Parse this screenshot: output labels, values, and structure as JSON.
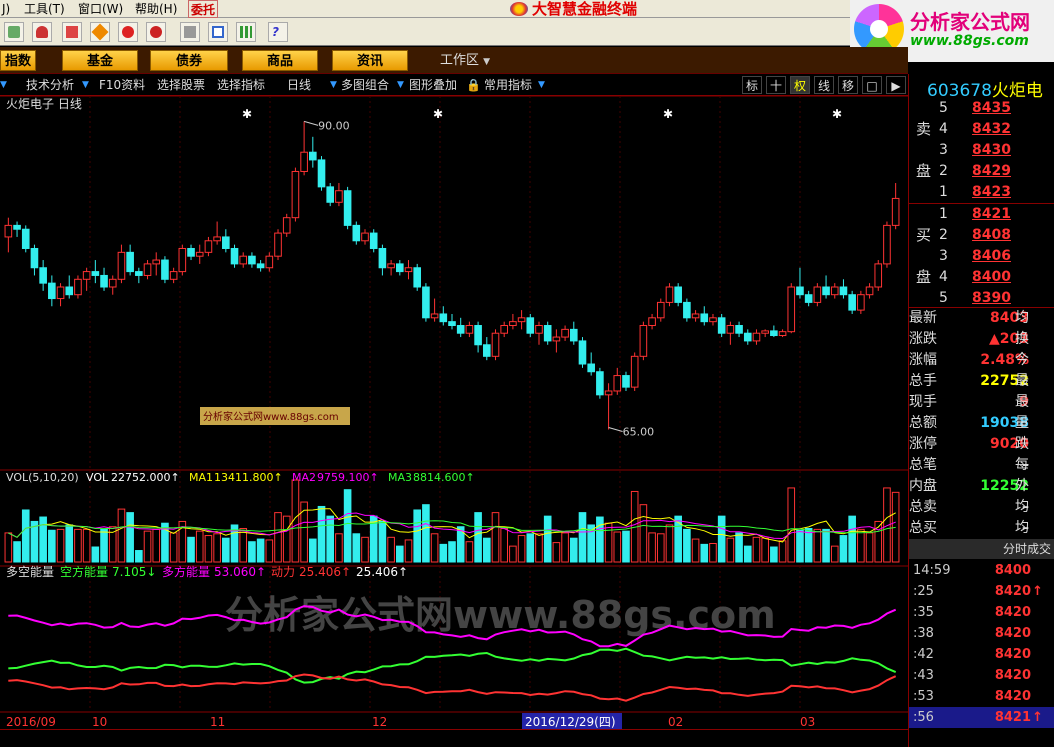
{
  "menu": {
    "items": [
      "J)",
      "工具(T)",
      "窗口(W)",
      "帮助(H)",
      "委托"
    ],
    "title": "大智慧金融终端"
  },
  "brand": {
    "name": "分析家公式网",
    "url": "www.88gs.com"
  },
  "categories": [
    "指数",
    "基金",
    "债券",
    "商品",
    "资讯"
  ],
  "workspace": "工作区",
  "funcbar": {
    "items": [
      "技术分析",
      "F10资料",
      "选择股票",
      "选择指标",
      "日线",
      "多图组合",
      "图形叠加",
      "常用指标"
    ],
    "right": [
      "标",
      "十",
      "权",
      "线",
      "移",
      "",
      ""
    ]
  },
  "stock": {
    "code": "603678",
    "name": "火炬电"
  },
  "orderbook": {
    "sell_label": [
      "卖",
      "盘"
    ],
    "buy_label": [
      "买",
      "盘"
    ],
    "sell": [
      {
        "level": "5",
        "price": "8435"
      },
      {
        "level": "4",
        "price": "8432"
      },
      {
        "level": "3",
        "price": "8430"
      },
      {
        "level": "2",
        "price": "8429"
      },
      {
        "level": "1",
        "price": "8423"
      }
    ],
    "buy": [
      {
        "level": "1",
        "price": "8421"
      },
      {
        "level": "2",
        "price": "8408"
      },
      {
        "level": "3",
        "price": "8406"
      },
      {
        "level": "4",
        "price": "8400"
      },
      {
        "level": "5",
        "price": "8390"
      }
    ]
  },
  "quote": [
    {
      "label": "最新",
      "value": "8403",
      "color": "#f33",
      "extra": "均"
    },
    {
      "label": "涨跌",
      "value": "▲203",
      "color": "#f33",
      "extra": "换"
    },
    {
      "label": "涨幅",
      "value": "2.48%",
      "color": "#f33",
      "extra": "今"
    },
    {
      "label": "总手",
      "value": "22752",
      "color": "#ff0",
      "extra": "最"
    },
    {
      "label": "现手",
      "value": "9",
      "color": "#f33",
      "extra": "最"
    },
    {
      "label": "总额",
      "value": "19038",
      "color": "#3cf",
      "extra": "量"
    },
    {
      "label": "涨停",
      "value": "9020",
      "color": "#f33",
      "extra": "跌"
    },
    {
      "label": "总笔",
      "value": "–",
      "color": "#ddd",
      "extra": "每"
    },
    {
      "label": "内盘",
      "value": "12252",
      "color": "#3f3",
      "extra": "外"
    },
    {
      "label": "总卖",
      "value": "–",
      "color": "#ddd",
      "extra": "均"
    },
    {
      "label": "总买",
      "value": "–",
      "color": "#ddd",
      "extra": "均"
    }
  ],
  "ticks_title": "分时成交",
  "ticks": [
    {
      "time": "14:59",
      "price": "8400",
      "arrow": ""
    },
    {
      "time": ":25",
      "price": "8420",
      "arrow": "↑"
    },
    {
      "time": ":35",
      "price": "8420",
      "arrow": ""
    },
    {
      "time": ":38",
      "price": "8420",
      "arrow": ""
    },
    {
      "time": ":42",
      "price": "8420",
      "arrow": ""
    },
    {
      "time": ":43",
      "price": "8420",
      "arrow": ""
    },
    {
      "time": ":53",
      "price": "8420",
      "arrow": ""
    },
    {
      "time": ":56",
      "price": "8421",
      "arrow": "↑"
    }
  ],
  "chart_data": {
    "type": "candlestick",
    "title": "火炬电子 日线",
    "price_max_label": "90.00",
    "price_min_label": "65.00",
    "date_cursor": "2016/12/29(四)",
    "x_labels": [
      "2016/09",
      "10",
      "11",
      "12",
      "01",
      "02",
      "03"
    ],
    "candles": [
      [
        75,
        77.5,
        73,
        76.5
      ],
      [
        76.5,
        77,
        75,
        76
      ],
      [
        76,
        76.5,
        73,
        73.5
      ],
      [
        73.5,
        74,
        70,
        71
      ],
      [
        71,
        72,
        68,
        69
      ],
      [
        69,
        70,
        66,
        67
      ],
      [
        67,
        69,
        66,
        68.5
      ],
      [
        68.5,
        70,
        67,
        67.5
      ],
      [
        67.5,
        70,
        67,
        69.5
      ],
      [
        69.5,
        71,
        68,
        70.5
      ],
      [
        70.5,
        72,
        69,
        70
      ],
      [
        70,
        71,
        68,
        68.5
      ],
      [
        68.5,
        70,
        67.5,
        69.5
      ],
      [
        69.5,
        74,
        69,
        73
      ],
      [
        73,
        74,
        70,
        70.5
      ],
      [
        70.5,
        71,
        69,
        70
      ],
      [
        70,
        72,
        69.5,
        71.5
      ],
      [
        71.5,
        73,
        70,
        72
      ],
      [
        72,
        72.5,
        69,
        69.5
      ],
      [
        69.5,
        71,
        69,
        70.5
      ],
      [
        70.5,
        74,
        70,
        73.5
      ],
      [
        73.5,
        74,
        72,
        72.5
      ],
      [
        72.5,
        74,
        71.5,
        73
      ],
      [
        73,
        75,
        72.5,
        74.5
      ],
      [
        74.5,
        77,
        74,
        75
      ],
      [
        75,
        76,
        73,
        73.5
      ],
      [
        73.5,
        74,
        71,
        71.5
      ],
      [
        71.5,
        73,
        71,
        72.5
      ],
      [
        72.5,
        73,
        71,
        71.5
      ],
      [
        71.5,
        72,
        70.5,
        71
      ],
      [
        71,
        73,
        70.5,
        72.5
      ],
      [
        72.5,
        76,
        72,
        75.5
      ],
      [
        75.5,
        78,
        75,
        77.5
      ],
      [
        77.5,
        84,
        77,
        83.5
      ],
      [
        83.5,
        90,
        83,
        86
      ],
      [
        86,
        88,
        84,
        85
      ],
      [
        85,
        85.5,
        81,
        81.5
      ],
      [
        81.5,
        82,
        79,
        79.5
      ],
      [
        79.5,
        82,
        79,
        81
      ],
      [
        81,
        81.5,
        76,
        76.5
      ],
      [
        76.5,
        77,
        74,
        74.5
      ],
      [
        74.5,
        76,
        74,
        75.5
      ],
      [
        75.5,
        76,
        73,
        73.5
      ],
      [
        73.5,
        74,
        70,
        71
      ],
      [
        71,
        72,
        70,
        71.5
      ],
      [
        71.5,
        72,
        70,
        70.5
      ],
      [
        70.5,
        72,
        69.5,
        71
      ],
      [
        71,
        71.5,
        68,
        68.5
      ],
      [
        68.5,
        69,
        64,
        64.5
      ],
      [
        64.5,
        67,
        64,
        65
      ],
      [
        65,
        66,
        63.5,
        64
      ],
      [
        64,
        65,
        63,
        63.5
      ],
      [
        63.5,
        64.5,
        62,
        62.5
      ],
      [
        62.5,
        64,
        62,
        63.5
      ],
      [
        63.5,
        64,
        60,
        61
      ],
      [
        61,
        62,
        59,
        59.5
      ],
      [
        59.5,
        63,
        59,
        62.5
      ],
      [
        62.5,
        64,
        62,
        63.5
      ],
      [
        63.5,
        65,
        63,
        64
      ],
      [
        64,
        65.5,
        63,
        64.5
      ],
      [
        64.5,
        65,
        62,
        62.5
      ],
      [
        62.5,
        64,
        61,
        63.5
      ],
      [
        63.5,
        64,
        61,
        61.5
      ],
      [
        61.5,
        63,
        60,
        62
      ],
      [
        62,
        63.5,
        61.5,
        63
      ],
      [
        63,
        64,
        61,
        61.5
      ],
      [
        61.5,
        62,
        58,
        58.5
      ],
      [
        58.5,
        60,
        57,
        57.5
      ],
      [
        57.5,
        58,
        54,
        54.5
      ],
      [
        54.5,
        56,
        50,
        55
      ],
      [
        55,
        58,
        54.5,
        57
      ],
      [
        57,
        57.5,
        55,
        55.5
      ],
      [
        55.5,
        60,
        55,
        59.5
      ],
      [
        59.5,
        64,
        59,
        63.5
      ],
      [
        63.5,
        65,
        63,
        64.5
      ],
      [
        64.5,
        67,
        64,
        66.5
      ],
      [
        66.5,
        69,
        66,
        68.5
      ],
      [
        68.5,
        69,
        66,
        66.5
      ],
      [
        66.5,
        67,
        64,
        64.5
      ],
      [
        64.5,
        65.5,
        64,
        65
      ],
      [
        65,
        66,
        63.5,
        64
      ],
      [
        64,
        65,
        63.5,
        64.5
      ],
      [
        64.5,
        65,
        62,
        62.5
      ],
      [
        62.5,
        64,
        61,
        63.5
      ],
      [
        63.5,
        64,
        62,
        62.5
      ],
      [
        62.5,
        63,
        61,
        61.5
      ],
      [
        61.5,
        63,
        61,
        62.5
      ],
      [
        62.5,
        63,
        62,
        62.8
      ],
      [
        62.8,
        63.5,
        62,
        62.2
      ],
      [
        62.2,
        63,
        62,
        62.7
      ],
      [
        62.7,
        69,
        62.5,
        68.5
      ],
      [
        68.5,
        71,
        67,
        67.5
      ],
      [
        67.5,
        68,
        66,
        66.5
      ],
      [
        66.5,
        69,
        66,
        68.5
      ],
      [
        68.5,
        70,
        67,
        67.5
      ],
      [
        67.5,
        69,
        67,
        68.5
      ],
      [
        68.5,
        69.5,
        67,
        67.5
      ],
      [
        67.5,
        68,
        65,
        65.5
      ],
      [
        65.5,
        68,
        65,
        67.5
      ],
      [
        67.5,
        69,
        67,
        68.5
      ],
      [
        68.5,
        72,
        68,
        71.5
      ],
      [
        71.5,
        77,
        71,
        76.5
      ],
      [
        76.5,
        82,
        76,
        80
      ]
    ],
    "vol_title": "VOL(5,10,20)",
    "vol_values": [
      {
        "name": "VOL",
        "value": "22752.000↑",
        "color": "#fff"
      },
      {
        "name": "MA1",
        "value": "13411.800↑",
        "color": "#ff0"
      },
      {
        "name": "MA2",
        "value": "9759.100↑",
        "color": "#f0f"
      },
      {
        "name": "MA3",
        "value": "8814.600↑",
        "color": "#3f3"
      }
    ],
    "indicator_title": "多空能量",
    "indicator_values": [
      {
        "name": "空方能量",
        "value": "7.105↓",
        "color": "#3f3"
      },
      {
        "name": "多方能量",
        "value": "53.060↑",
        "color": "#f0f"
      },
      {
        "name": "动力",
        "value": "25.406↑",
        "color": "#f33"
      },
      {
        "name": "",
        "value": "25.406↑",
        "color": "#fff"
      }
    ],
    "watermark": "分析家公式网www.88gs.com",
    "inline_tag": "分析家公式网www.88gs.com"
  }
}
